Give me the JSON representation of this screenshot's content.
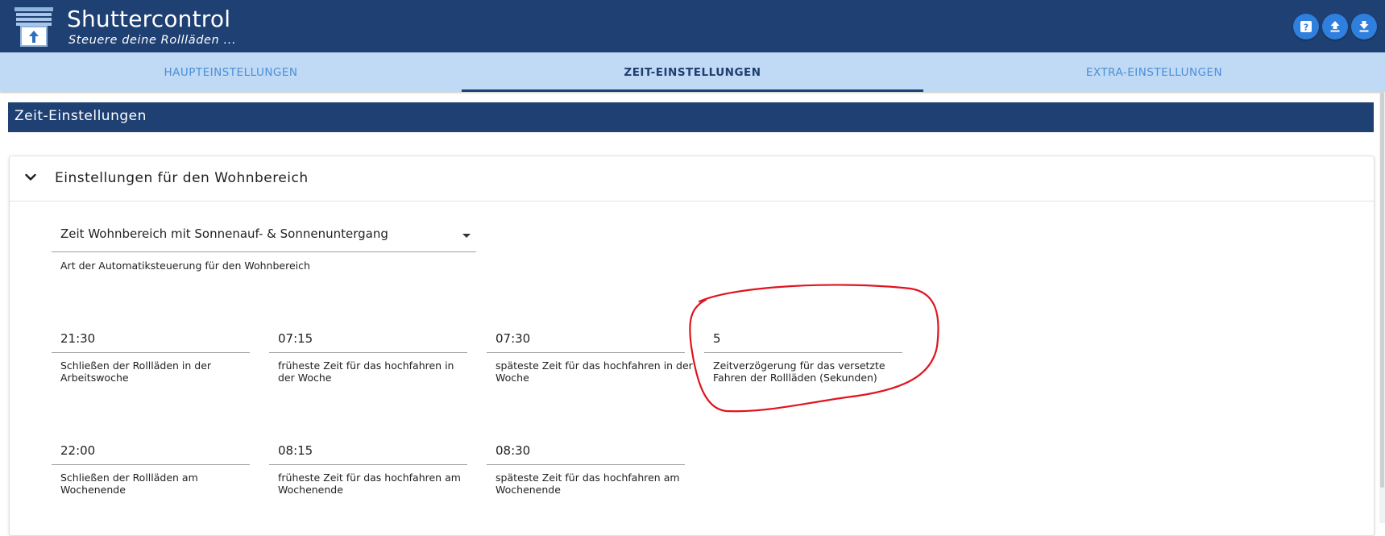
{
  "app": {
    "title": "Shuttercontrol",
    "subtitle": "Steuere deine Rollläden ..."
  },
  "header_buttons": [
    {
      "name": "help-button",
      "icon": "help-icon"
    },
    {
      "name": "upload-button",
      "icon": "upload-icon"
    },
    {
      "name": "download-button",
      "icon": "download-icon"
    }
  ],
  "tabs": [
    {
      "label": "HAUPTEINSTELLUNGEN",
      "active": false
    },
    {
      "label": "ZEIT-EINSTELLUNGEN",
      "active": true
    },
    {
      "label": "EXTRA-EINSTELLUNGEN",
      "active": false
    }
  ],
  "section": {
    "title": "Zeit-Einstellungen"
  },
  "panel": {
    "title": "Einstellungen für den Wohnbereich",
    "select": {
      "value": "Zeit Wohnbereich mit Sonnenauf- & Sonnenuntergang",
      "helper": "Art der Automatiksteuerung für den Wohnbereich"
    },
    "fields": [
      {
        "value": "21:30",
        "helper": "Schließen der Rollläden in der Arbeitswoche"
      },
      {
        "value": "07:15",
        "helper": "früheste Zeit für das hochfahren in der Woche"
      },
      {
        "value": "07:30",
        "helper": "späteste Zeit für das hochfahren in der Woche"
      },
      {
        "value": "5",
        "helper": "Zeitverzögerung für das versetzte Fahren der Rollläden (Sekunden)"
      },
      {
        "value": "22:00",
        "helper": "Schließen der Rollläden am Wochenende"
      },
      {
        "value": "08:15",
        "helper": "früheste Zeit für das hochfahren am Wochenende"
      },
      {
        "value": "08:30",
        "helper": "späteste Zeit für das hochfahren am Wochenende"
      }
    ]
  },
  "colors": {
    "header_bg": "#1f4073",
    "tab_bar_bg": "#c0d9f4",
    "tab_inactive_text": "#4a90d9",
    "button_bg": "#2f7fde",
    "annotation": "#e0141e"
  }
}
